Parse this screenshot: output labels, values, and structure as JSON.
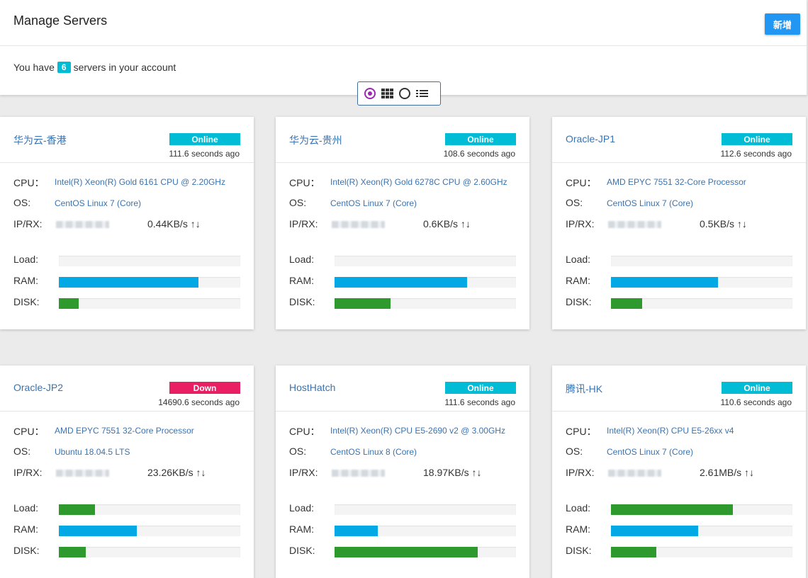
{
  "header": {
    "title": "Manage Servers",
    "add_button": "新增",
    "summary_prefix": "You have",
    "server_count": "6",
    "summary_suffix": "servers in your account"
  },
  "view_toggle": {
    "selected": "grid"
  },
  "labels": {
    "cpu": "CPU：",
    "os": "OS:",
    "iprx": "IP/RX:",
    "load": "Load:",
    "ram": "RAM:",
    "disk": "DISK:"
  },
  "colors": {
    "online": "#00bcd4",
    "down": "#e91e63",
    "ram_bar": "#03a9e4",
    "load_disk_bar": "#2e9a2e",
    "accent": "#2196f3"
  },
  "servers": [
    {
      "name": "华为云-香港",
      "status": "Online",
      "status_type": "online",
      "last_seen": "111.6 seconds ago",
      "cpu": "Intel(R) Xeon(R) Gold 6161 CPU @ 2.20GHz",
      "os": "CentOS Linux 7 (Core)",
      "rx": "0.44KB/s ↑↓",
      "load": 0,
      "ram": 77,
      "disk": 11
    },
    {
      "name": "华为云-贵州",
      "status": "Online",
      "status_type": "online",
      "last_seen": "108.6 seconds ago",
      "cpu": "Intel(R) Xeon(R) Gold 6278C CPU @ 2.60GHz",
      "os": "CentOS Linux 7 (Core)",
      "rx": "0.6KB/s ↑↓",
      "load": 0,
      "ram": 73,
      "disk": 31
    },
    {
      "name": "Oracle-JP1",
      "status": "Online",
      "status_type": "online",
      "last_seen": "112.6 seconds ago",
      "cpu": "AMD EPYC 7551 32-Core Processor",
      "os": "CentOS Linux 7 (Core)",
      "rx": "0.5KB/s ↑↓",
      "load": 0,
      "ram": 59,
      "disk": 17
    },
    {
      "name": "Oracle-JP2",
      "status": "Down",
      "status_type": "down",
      "last_seen": "14690.6 seconds ago",
      "cpu": "AMD EPYC 7551 32-Core Processor",
      "os": "Ubuntu 18.04.5 LTS",
      "rx": "23.26KB/s ↑↓",
      "load": 20,
      "ram": 43,
      "disk": 15
    },
    {
      "name": "HostHatch",
      "status": "Online",
      "status_type": "online",
      "last_seen": "111.6 seconds ago",
      "cpu": "Intel(R) Xeon(R) CPU E5-2690 v2 @ 3.00GHz",
      "os": "CentOS Linux 8 (Core)",
      "rx": "18.97KB/s ↑↓",
      "load": 0,
      "ram": 24,
      "disk": 79
    },
    {
      "name": "腾讯-HK",
      "status": "Online",
      "status_type": "online",
      "last_seen": "110.6 seconds ago",
      "cpu": "Intel(R) Xeon(R) CPU E5-26xx v4",
      "os": "CentOS Linux 7 (Core)",
      "rx": "2.61MB/s ↑↓",
      "load": 67,
      "ram": 48,
      "disk": 25
    }
  ]
}
